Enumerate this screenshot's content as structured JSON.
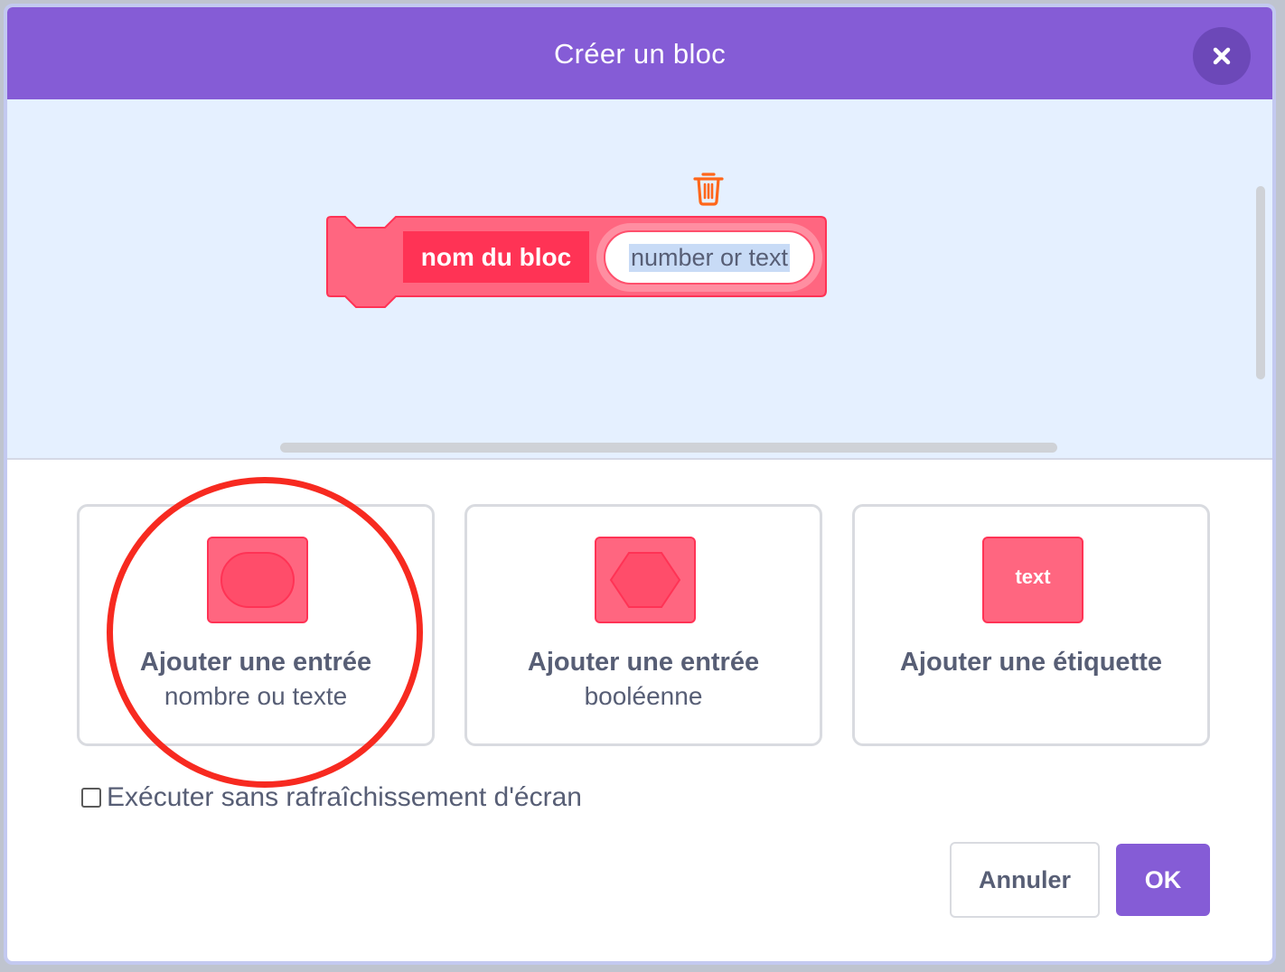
{
  "dialog": {
    "title": "Créer un bloc",
    "close_icon": "close-icon"
  },
  "block_preview": {
    "label": "nom du bloc",
    "input_placeholder": "number or text",
    "delete_icon": "trash-icon",
    "color": "#ff6680",
    "label_color": "#ff3355"
  },
  "options": [
    {
      "title": "Ajouter une entrée",
      "subtitle": "nombre ou texte",
      "icon": "round-input-icon"
    },
    {
      "title": "Ajouter une entrée",
      "subtitle": "booléenne",
      "icon": "boolean-input-icon"
    },
    {
      "title": "Ajouter une étiquette",
      "subtitle": "",
      "icon": "label-icon",
      "icon_text": "text"
    }
  ],
  "checkbox": {
    "label": "Exécuter sans rafraîchissement d'écran",
    "checked": false
  },
  "buttons": {
    "cancel": "Annuler",
    "ok": "OK"
  },
  "colors": {
    "header": "#855cd6",
    "workspace": "#e5f0ff",
    "annotation": "#f72a20"
  }
}
